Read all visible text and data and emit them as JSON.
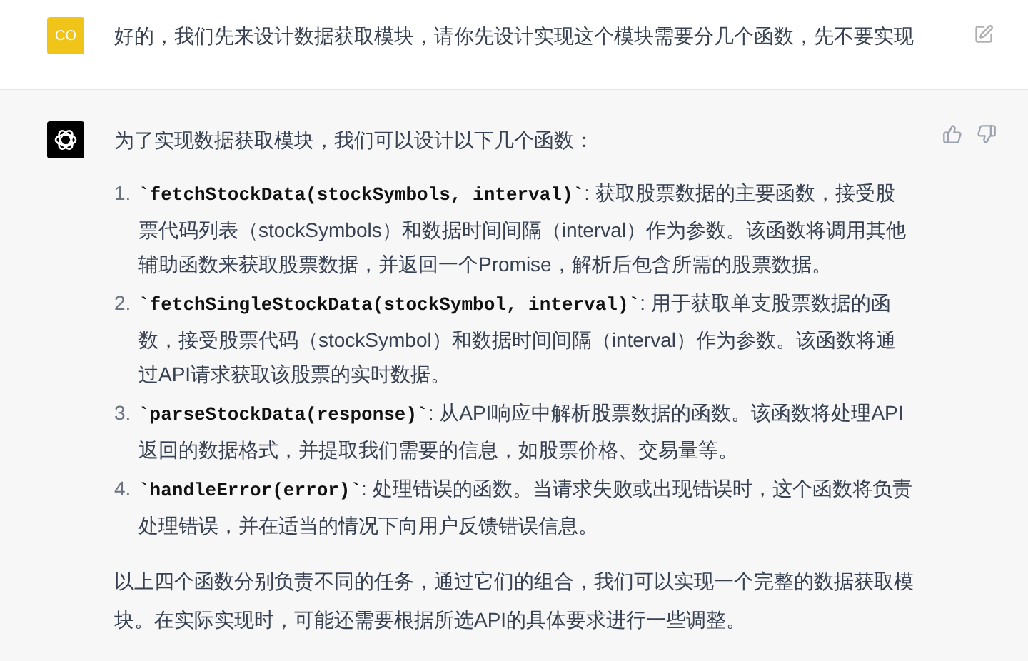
{
  "user_message": {
    "avatar": "CO",
    "text": "好的，我们先来设计数据获取模块，请你先设计实现这个模块需要分几个函数，先不要实现"
  },
  "assistant_message": {
    "intro": "为了实现数据获取模块，我们可以设计以下几个函数：",
    "items": [
      {
        "number": "1.",
        "code": "`fetchStockData(stockSymbols, interval)`",
        "text": ": 获取股票数据的主要函数，接受股票代码列表（stockSymbols）和数据时间间隔（interval）作为参数。该函数将调用其他辅助函数来获取股票数据，并返回一个Promise，解析后包含所需的股票数据。"
      },
      {
        "number": "2.",
        "code": "`fetchSingleStockData(stockSymbol, interval)`",
        "text": ": 用于获取单支股票数据的函数，接受股票代码（stockSymbol）和数据时间间隔（interval）作为参数。该函数将通过API请求获取该股票的实时数据。"
      },
      {
        "number": "3.",
        "code": "`parseStockData(response)`",
        "text": ": 从API响应中解析股票数据的函数。该函数将处理API返回的数据格式，并提取我们需要的信息，如股票价格、交易量等。"
      },
      {
        "number": "4.",
        "code": "`handleError(error)`",
        "text": ": 处理错误的函数。当请求失败或出现错误时，这个函数将负责处理错误，并在适当的情况下向用户反馈错误信息。"
      }
    ],
    "summary": "以上四个函数分别负责不同的任务，通过它们的组合，我们可以实现一个完整的数据获取模块。在实际实现时，可能还需要根据所选API的具体要求进行一些调整。"
  }
}
